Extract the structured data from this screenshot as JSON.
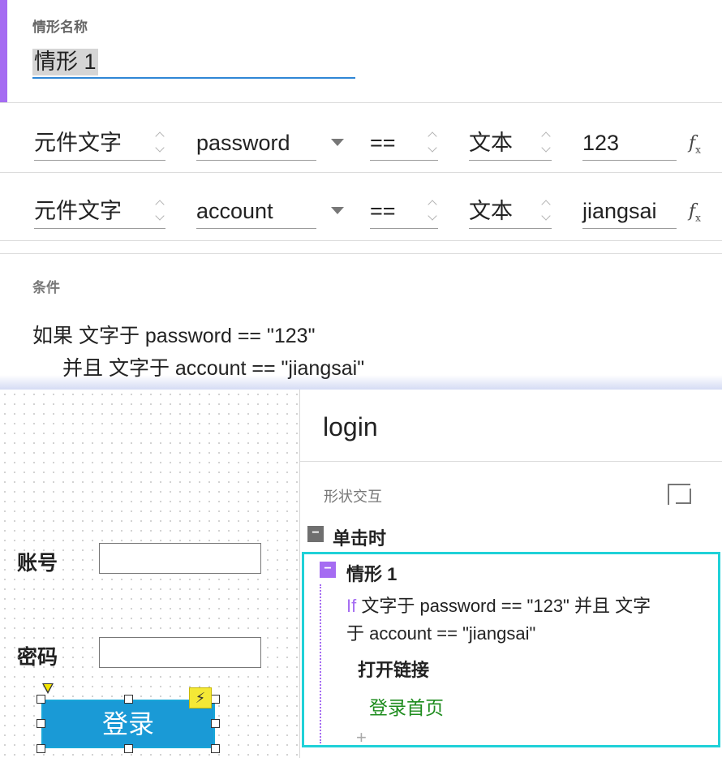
{
  "case_editor": {
    "name_label": "情形名称",
    "case_name": "情形 1",
    "rows": [
      {
        "target_type": "元件文字",
        "widget": "password",
        "operator": "==",
        "value_type": "文本",
        "value": "123",
        "fx_label": "f",
        "fx_sub": "x"
      },
      {
        "target_type": "元件文字",
        "widget": "account",
        "operator": "==",
        "value_type": "文本",
        "value": "jiangsai",
        "fx_label": "f",
        "fx_sub": "x"
      }
    ],
    "conditions_title": "条件",
    "condition_line1": "如果 文字于 password == \"123\"",
    "condition_line2": "并且 文字于 account == \"jiangsai\""
  },
  "canvas": {
    "account_label": "账号",
    "password_label": "密码",
    "login_button": "登录",
    "interaction_badge": "⚡"
  },
  "inspector": {
    "widget_name": "login",
    "section_title": "形状交互",
    "event_name": "单击时",
    "event_toggle": "−",
    "case_toggle": "−",
    "case_title": "情形 1",
    "if_keyword": "If",
    "condition_line1": " 文字于 password == \"123\" 并且 文字",
    "condition_line2": "于 account == \"jiangsai\"",
    "action_name": "打开链接",
    "action_target": "登录首页",
    "add_action": "+"
  },
  "colors": {
    "accent_purple": "#a56cf2",
    "case_border_cyan": "#1fd1d8",
    "button_blue": "#1a9ad6",
    "link_green": "#1e8c1e"
  }
}
